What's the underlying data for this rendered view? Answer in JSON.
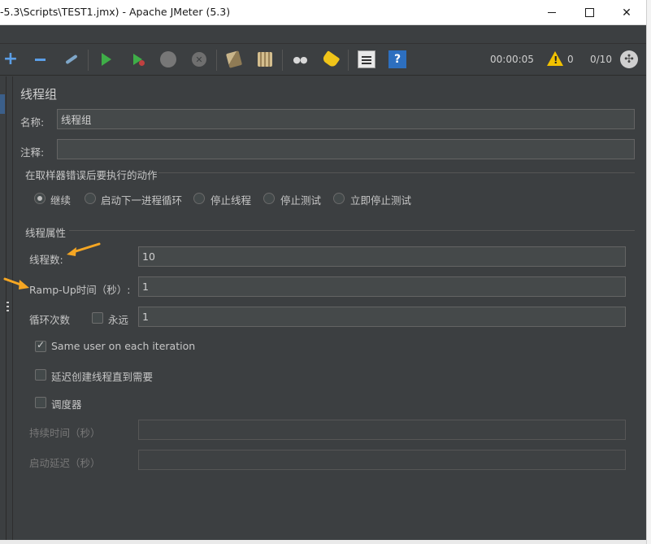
{
  "window": {
    "title": "-5.3\\Scripts\\TEST1.jmx) - Apache JMeter (5.3)"
  },
  "toolbar": {
    "timer": "00:00:05",
    "warnings": "0",
    "threads": "0/10",
    "icons": [
      "add-icon",
      "remove-icon",
      "toggle-icon",
      "start-icon",
      "start-no-pauses-icon",
      "stop-icon",
      "shutdown-icon",
      "clear-icon",
      "clear-all-icon",
      "search-icon",
      "reset-search-icon",
      "function-helper-icon",
      "help-icon",
      "warning-icon",
      "remote-icon"
    ]
  },
  "panel": {
    "title": "线程组",
    "name_label": "名称:",
    "name_value": "线程组",
    "comment_label": "注释:",
    "comment_value": "",
    "error_section": "在取样器错误后要执行的动作",
    "error_actions": [
      {
        "label": "继续",
        "checked": true
      },
      {
        "label": "启动下一进程循环",
        "checked": false
      },
      {
        "label": "停止线程",
        "checked": false
      },
      {
        "label": "停止测试",
        "checked": false
      },
      {
        "label": "立即停止测试",
        "checked": false
      }
    ],
    "thread_section": "线程属性",
    "threads_label": "线程数:",
    "threads_value": "10",
    "rampup_label": "Ramp-Up时间（秒）:",
    "rampup_value": "1",
    "loop_label": "循环次数",
    "forever_label": "永远",
    "forever_checked": false,
    "loop_value": "1",
    "same_user_label": "Same user on each iteration",
    "same_user_checked": true,
    "delay_label": "延迟创建线程直到需要",
    "delay_checked": false,
    "scheduler_label": "调度器",
    "scheduler_checked": false,
    "duration_label": "持续时间（秒）",
    "duration_value": "",
    "startup_delay_label": "启动延迟（秒）",
    "startup_delay_value": ""
  },
  "colors": {
    "background": "#3c3f41",
    "field": "#45494a",
    "arrow": "#f5a623"
  }
}
